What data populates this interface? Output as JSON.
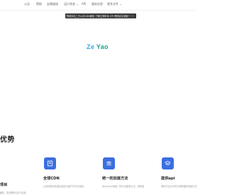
{
  "nav": {
    "items": [
      {
        "label": "公告",
        "has_dropdown": false
      },
      {
        "label": "赞助",
        "has_dropdown": false
      },
      {
        "label": "友情链接",
        "has_dropdown": false
      },
      {
        "label": "运行状态",
        "has_dropdown": true
      },
      {
        "label": "API",
        "has_dropdown": false
      },
      {
        "label": "服务信息",
        "has_dropdown": false
      },
      {
        "label": "更多文件",
        "has_dropdown": true
      }
    ]
  },
  "banner": {
    "text": "赞助本站二方公共CDN服务 了解立即申请 CPI 赞助实名领取！！！"
  },
  "brand": {
    "part1": "Ze",
    "part2": "Yao"
  },
  "section": {
    "title": "优势"
  },
  "features": [
    {
      "title": "项目",
      "desc": "缓存，配合腾讯云EO加速"
    },
    {
      "title": "全球CDN",
      "desc": "让你的静态资源在最靠近用户的节点响应",
      "icon": "book-icon"
    },
    {
      "title": "统一的加速方法",
      "desc": "将jsdelivr和统一的方法服务方法，简单易",
      "icon": "users-icon"
    },
    {
      "title": "提供api",
      "desc": "提供丰富公开的方便快捷的调用方式",
      "icon": "layers-icon"
    }
  ],
  "colors": {
    "accent": "#3b6fe0",
    "banner_bg": "#3a3a3a",
    "brand_ze": "#2fa9e0",
    "brand_yao": "#1f9e8f"
  }
}
